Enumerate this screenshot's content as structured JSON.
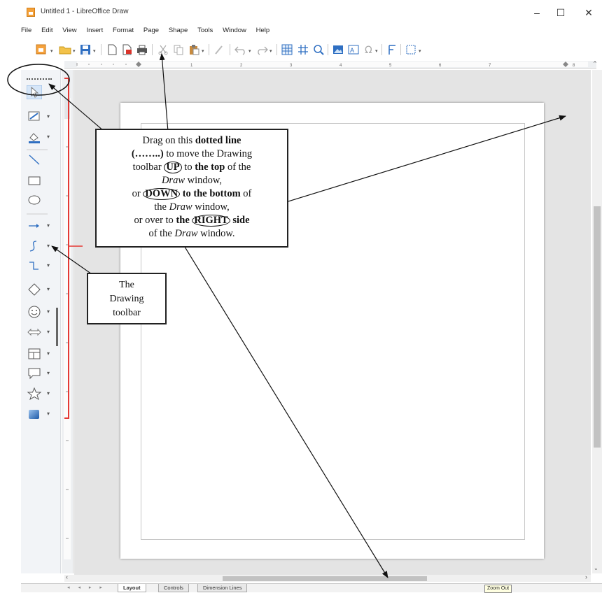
{
  "window": {
    "title": "Untitled 1 - LibreOffice Draw",
    "minimize": "–",
    "maximize": "☐",
    "close": "✕"
  },
  "menu": [
    "File",
    "Edit",
    "View",
    "Insert",
    "Format",
    "Page",
    "Shape",
    "Tools",
    "Window",
    "Help"
  ],
  "toolbar_icons": [
    "new-document-icon",
    "open-folder-icon",
    "save-icon",
    "export-icon",
    "export-pdf-icon",
    "print-icon",
    "cut-icon",
    "copy-icon",
    "paste-icon",
    "clone-formatting-icon",
    "undo-icon",
    "redo-icon",
    "grid-icon",
    "helplines-icon",
    "zoom-icon",
    "image-icon",
    "text-box-icon",
    "special-character-icon",
    "fontwork-icon",
    "transformations-icon"
  ],
  "drawing_toolbar_icons": [
    "select-icon",
    "line-color-icon",
    "fill-color-icon",
    "line-icon",
    "rectangle-icon",
    "ellipse-icon",
    "arrow-line-icon",
    "curve-icon",
    "connector-icon",
    "basic-shapes-icon",
    "symbol-shapes-icon",
    "block-arrows-icon",
    "flowchart-icon",
    "callouts-icon",
    "stars-icon",
    "3d-objects-icon"
  ],
  "ruler_numbers": [
    "1",
    "2",
    "3",
    "4",
    "5",
    "6",
    "7",
    "8"
  ],
  "tabs": [
    "Layout",
    "Controls",
    "Dimension Lines"
  ],
  "tab_nav": "◂ ◂ ▸ ▸",
  "tooltip": "Zoom Out",
  "callout_main": {
    "line1_a": "Drag on this ",
    "line1_b": "dotted line",
    "line2_a": "(……..)",
    "line2_b": " to move the Drawing",
    "line3_a": "toolbar ",
    "line3_b": "UP",
    "line3_c": " to ",
    "line3_d": "the top",
    "line3_e": " of the",
    "line4_a": "Draw",
    "line4_b": " window,",
    "line5_a": "or ",
    "line5_b": "DOWN",
    "line5_c": " to the bottom",
    "line5_d": " of",
    "line6_a": "the ",
    "line6_b": "Draw",
    "line6_c": " window,",
    "line7_a": "or over to ",
    "line7_b": "the",
    "line7_c": "RIGHT",
    "line7_d": " side",
    "line8_a": "of the ",
    "line8_b": "Draw",
    "line8_c": " window."
  },
  "callout_small": {
    "line1": "The",
    "line2": "Drawing",
    "line3": "toolbar"
  },
  "colors": {
    "bracket": "#e53935",
    "arrow": "#111111",
    "accent_icon": "#1e6fc8"
  }
}
